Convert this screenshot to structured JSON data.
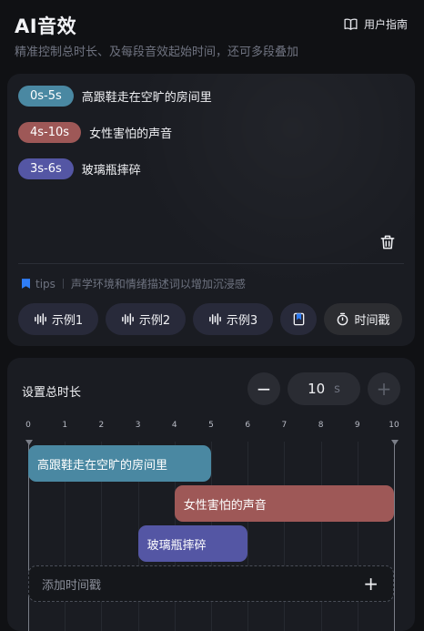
{
  "header": {
    "title": "AI音效",
    "guide_label": "用户指南",
    "subtitle": "精准控制总时长、及每段音效起始时间，还可多段叠加"
  },
  "prompts": [
    {
      "time": "0s-5s",
      "text": "高跟鞋走在空旷的房间里",
      "color": "#4a88a2"
    },
    {
      "time": "4s-10s",
      "text": "女性害怕的声音",
      "color": "#9e5857"
    },
    {
      "time": "3s-6s",
      "text": "玻璃瓶摔碎",
      "color": "#5456a4"
    }
  ],
  "tips": {
    "label": "tips",
    "text": "声学环境和情绪描述词以增加沉浸感"
  },
  "buttons": {
    "example1": "示例1",
    "example2": "示例2",
    "example3": "示例3",
    "timestamp": "时间戳"
  },
  "duration": {
    "label": "设置总时长",
    "value": "10",
    "unit": "s",
    "minus": "−",
    "plus": "+"
  },
  "timeline": {
    "ticks": [
      "0",
      "1",
      "2",
      "3",
      "4",
      "5",
      "6",
      "7",
      "8",
      "9",
      "10"
    ],
    "segments": [
      {
        "label": "高跟鞋走在空旷的房间里",
        "start": 0,
        "end": 5,
        "color": "#4a88a2"
      },
      {
        "label": "女性害怕的声音",
        "start": 4,
        "end": 10,
        "color": "#9e5857"
      },
      {
        "label": "玻璃瓶摔碎",
        "start": 3,
        "end": 6,
        "color": "#5456a4"
      }
    ],
    "add_label": "添加时间戳",
    "add_plus": "+"
  }
}
